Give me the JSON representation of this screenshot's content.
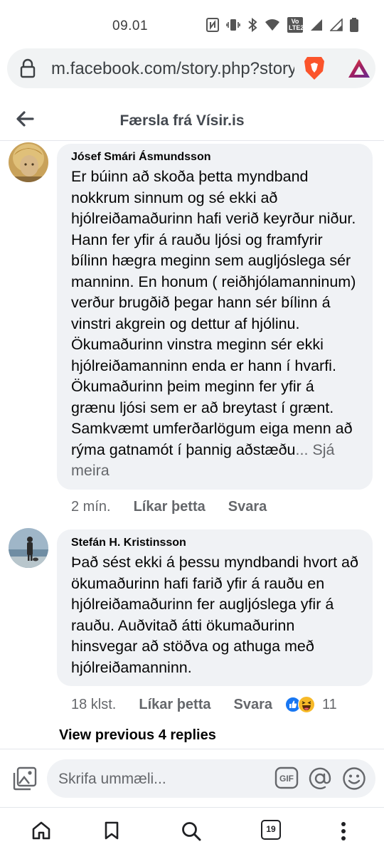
{
  "status_bar": {
    "time": "09.01",
    "lte_label": "LTE2"
  },
  "browser": {
    "url": "m.facebook.com/story.php?story_",
    "tab_count": "19"
  },
  "header": {
    "title": "Færsla frá Vísir.is"
  },
  "comments": [
    {
      "author": "Jósef Smári Ásmundsson",
      "text": "Er búinn að skoða þetta myndband nokkrum sinnum og sé ekki að hjólreiðamaðurinn hafi verið keyrður niður. Hann fer yfir á rauðu ljósi og framfyrir bílinn hægra meginn sem augljóslega sér manninn. En honum ( reiðhjólamanninum) verður brugðið þegar hann sér bílinn á vinstri akgrein og dettur af hjólinu. Ökumaðurinn vinstra meginn sér ekki hjólreiðamanninn enda er hann í hvarfi. Ökumaðurinn þeim meginn fer yfir á grænu ljósi sem er að breytast í grænt. Samkvæmt umferðarlögum eiga menn að rýma gatnamót í þannig aðstæðu",
      "see_more": "... Sjá meira",
      "time": "2 mín.",
      "like_label": "Líkar þetta",
      "reply_label": "Svara"
    },
    {
      "author": "Stefán H. Kristinsson",
      "text": "Það sést ekki á þessu myndbandi hvort að ökumaðurinn hafi farið yfir á rauðu en hjólreiðamaðurinn fer augljóslega yfir á rauðu.  Auðvitað átti ökumaðurinn hinsvegar að stöðva og athuga með hjólreiðamanninn.",
      "time": "18 klst.",
      "like_label": "Líkar þetta",
      "reply_label": "Svara",
      "reaction_count": "11",
      "reactions": [
        "like-reaction-icon",
        "haha-reaction-icon"
      ]
    }
  ],
  "view_previous": "View previous 4 replies",
  "composer": {
    "placeholder": "Skrifa ummæli...",
    "gif_label": "GIF"
  },
  "colors": {
    "bubble": "#f0f2f5",
    "meta_text": "#65676b",
    "like_blue": "#1877f2",
    "haha_yellow": "#f7b928",
    "brave_orange": "#fb542b"
  }
}
